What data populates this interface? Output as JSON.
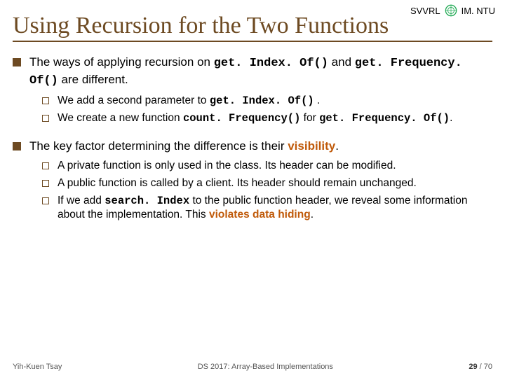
{
  "header": {
    "org_left": "SVVRL",
    "logo": "seal",
    "org_right": "IM. NTU"
  },
  "title": "Using Recursion for the Two Functions",
  "bullets": [
    {
      "pre": "The ways of applying recursion on ",
      "code1": "get. Index. Of()",
      "mid": " and ",
      "code2": "get. Frequency. Of()",
      "post": " are different.",
      "subs": [
        {
          "pre": "We add a second parameter to ",
          "code1": "get. Index. Of()",
          "post": " ."
        },
        {
          "pre": "We create a new function ",
          "code1": "count. Frequency()",
          "mid": " for ",
          "code2": "get. Frequency. Of()",
          "post": "."
        }
      ]
    },
    {
      "pre": "The key factor determining the difference is their ",
      "kw": "visibility",
      "post": ".",
      "subs": [
        {
          "text": "A private function is only used in the class. Its header can be modified."
        },
        {
          "text": "A public function is called by a client. Its header should remain unchanged."
        },
        {
          "pre": "If we add ",
          "code1": "search. Index",
          "mid": " to the public function header, we reveal some information about the implementation. This ",
          "kw": "violates data hiding",
          "post": "."
        }
      ]
    }
  ],
  "footer": {
    "left": "Yih-Kuen Tsay",
    "center": "DS 2017: Array-Based Implementations",
    "page_current": "29",
    "page_sep": " / ",
    "page_total": "70"
  }
}
